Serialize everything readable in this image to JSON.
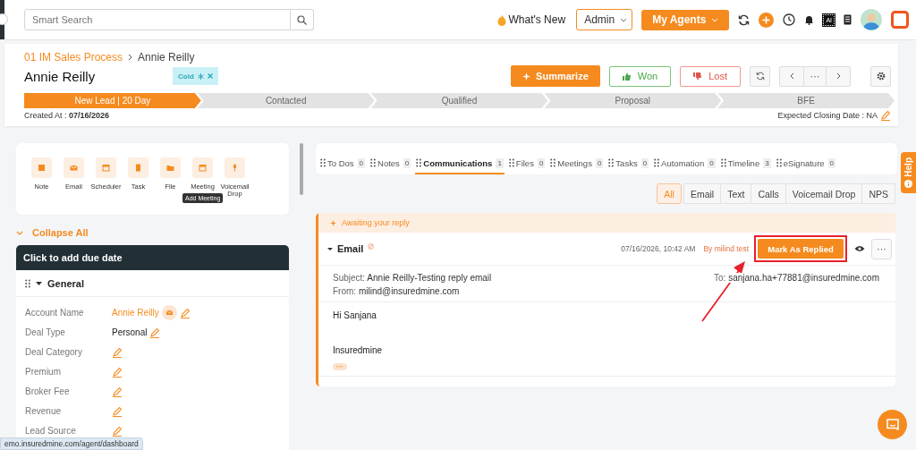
{
  "topbar": {
    "search": {
      "placeholder": "Smart Search"
    },
    "whats_new": "What's New",
    "role_select": "Admin",
    "agents_button": "My Agents",
    "ai_chip": "AI"
  },
  "deal": {
    "breadcrumb": [
      "01 IM Sales Process",
      "Annie Reilly"
    ],
    "title": "Annie Reilly",
    "tag": "Cold",
    "summarize": "Summarize",
    "won": "Won",
    "lost": "Lost",
    "more": "···",
    "stages": [
      {
        "label": "New Lead | 20 Day",
        "selected": true
      },
      {
        "label": "Contacted",
        "selected": false
      },
      {
        "label": "Qualified",
        "selected": false
      },
      {
        "label": "Proposal",
        "selected": false
      },
      {
        "label": "BFE",
        "selected": false
      }
    ],
    "created_label": "Created At :",
    "created_date": "07/16/2026",
    "closing": "Expected Closing Date : NA"
  },
  "actions": [
    {
      "label": "Note"
    },
    {
      "label": "Email"
    },
    {
      "label": "Scheduler"
    },
    {
      "label": "Task"
    },
    {
      "label": "File"
    },
    {
      "label": "Meeting",
      "tooltip": "Add Meeting"
    },
    {
      "label": "Voicemail Drop"
    }
  ],
  "collapse_all": "Collapse All",
  "due_date_bar": "Click to add due date",
  "section_title": "General",
  "fields": [
    {
      "label": "Account Name",
      "value": "Annie Reilly",
      "kind": "link"
    },
    {
      "label": "Deal Type",
      "value": "Personal",
      "kind": "text"
    },
    {
      "label": "Deal Category",
      "kind": "empty"
    },
    {
      "label": "Premium",
      "kind": "empty"
    },
    {
      "label": "Broker Fee",
      "kind": "empty"
    },
    {
      "label": "Revenue",
      "kind": "empty"
    },
    {
      "label": "Lead Source",
      "kind": "empty"
    }
  ],
  "tabs": [
    {
      "label": "To Dos",
      "count": "0",
      "selected": false
    },
    {
      "label": "Notes",
      "count": "0",
      "selected": false
    },
    {
      "label": "Communications",
      "count": "1",
      "selected": true
    },
    {
      "label": "Files",
      "count": "0",
      "selected": false
    },
    {
      "label": "Meetings",
      "count": "0",
      "selected": false
    },
    {
      "label": "Tasks",
      "count": "0",
      "selected": false
    },
    {
      "label": "Automation",
      "count": "0",
      "selected": false
    },
    {
      "label": "Timeline",
      "count": "3",
      "selected": false
    },
    {
      "label": "eSignature",
      "count": "0",
      "selected": false
    }
  ],
  "filters": [
    {
      "label": "All",
      "selected": true
    },
    {
      "label": "Email",
      "selected": false
    },
    {
      "label": "Text",
      "selected": false
    },
    {
      "label": "Calls",
      "selected": false
    },
    {
      "label": "Voicemail Drop",
      "selected": false
    },
    {
      "label": "NPS",
      "selected": false
    }
  ],
  "awaiting": "Awaiting your reply",
  "email": {
    "type": "Email",
    "timestamp": "07/16/2026, 10:42 AM",
    "author": "By milind test",
    "mark_button": "Mark As Replied",
    "more": "···",
    "subject_label": "Subject:",
    "subject": "Annie Reilly-Testing reply email",
    "from_label": "From:",
    "from": "milind@insuredmine.com",
    "to_label": "To:",
    "to": "sanjana.ha+77881@insuredmine.com",
    "body": [
      "Hi Sanjana",
      "Insuredmine"
    ],
    "expand": "···"
  },
  "help": "Help",
  "status_url": "emo.insuredmine.com/agent/dashboard"
}
